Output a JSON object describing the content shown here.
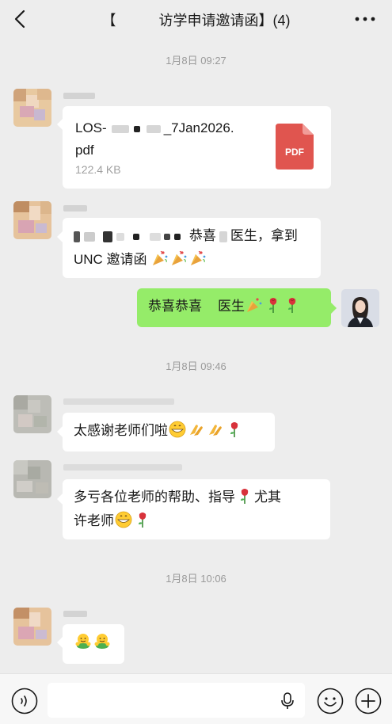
{
  "header": {
    "title": "【　　　访学申请邀请函】(4)",
    "more_label": "···"
  },
  "chat": {
    "messages": [
      {
        "time": "1月8日 09:27"
      },
      {
        "file_name": "LOS-　　　　　_7Jan2026.pdf",
        "file_name_line1": "LOS-",
        "file_name_line1b": "_7Jan2026.",
        "file_name_line2": "pdf",
        "file_size": "122.4 KB",
        "file_badge": "PDF"
      },
      {
        "text_line1_a": "恭喜",
        "text_line1_b": "医生，拿到",
        "text_line2": "UNC 邀请函"
      },
      {
        "text_a": "恭喜恭喜",
        "text_b": "医生"
      },
      {
        "time": "1月8日 09:46"
      },
      {
        "text": "太感谢老师们啦"
      },
      {
        "text_line1": "多亏各位老师的帮助、指导",
        "text_line1_b": "尤其",
        "text_line2": "许老师"
      },
      {
        "time": "1月8日 10:06"
      },
      {
        "text": ""
      }
    ]
  },
  "footer": {
    "input_placeholder": ""
  },
  "colors": {
    "background": "#ededed",
    "bubble_self": "#95ec69",
    "bubble_other": "#ffffff",
    "pdf_red": "#e0554f"
  },
  "icons": [
    "back-arrow-icon",
    "more-dots-icon",
    "pdf-file-icon",
    "voice-icon",
    "microphone-icon",
    "emoji-icon",
    "plus-icon"
  ]
}
